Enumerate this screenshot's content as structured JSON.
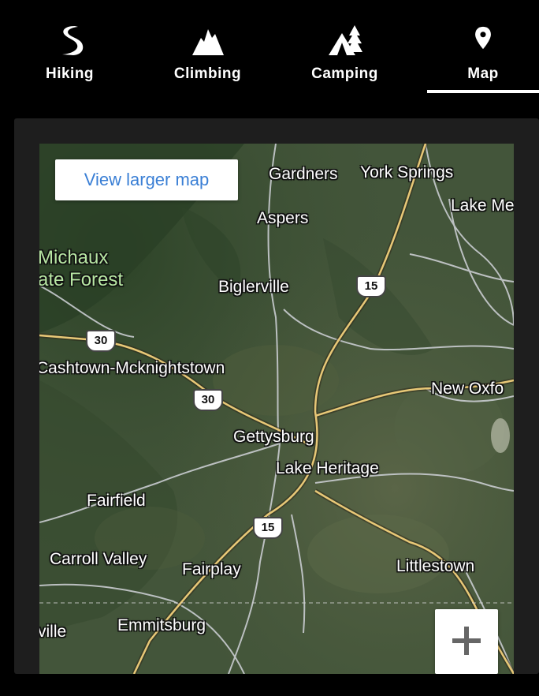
{
  "nav": {
    "tabs": [
      {
        "label": "Hiking",
        "icon": "hiking-trail-icon"
      },
      {
        "label": "Climbing",
        "icon": "mountain-icon"
      },
      {
        "label": "Camping",
        "icon": "tent-icon"
      },
      {
        "label": "Map",
        "icon": "map-pin-icon",
        "active": true
      }
    ]
  },
  "map": {
    "view_larger_label": "View larger map",
    "places": {
      "gardners": "Gardners",
      "york_springs": "York Springs",
      "lake_meade": "Lake Me",
      "aspers": "Aspers",
      "michaux_1": "Michaux",
      "michaux_2": "ate Forest",
      "biglerville": "Biglerville",
      "cashtown": "Cashtown-Mcknightstown",
      "new_oxford": "New Oxfo",
      "gettysburg": "Gettysburg",
      "lake_heritage": "Lake Heritage",
      "fairfield": "Fairfield",
      "carroll_valley": "Carroll Valley",
      "fairplay": "Fairplay",
      "littlestown": "Littlestown",
      "ville": "ville",
      "emmitsburg": "Emmitsburg"
    },
    "shields": {
      "us15_north": "15",
      "us30_west": "30",
      "us30_mid": "30",
      "us15_south": "15"
    },
    "zoom_in_icon": "plus-icon",
    "colors": {
      "highway": "#e8c877",
      "road": "#c9ccd0",
      "label_link": "#3a7fd5"
    }
  }
}
